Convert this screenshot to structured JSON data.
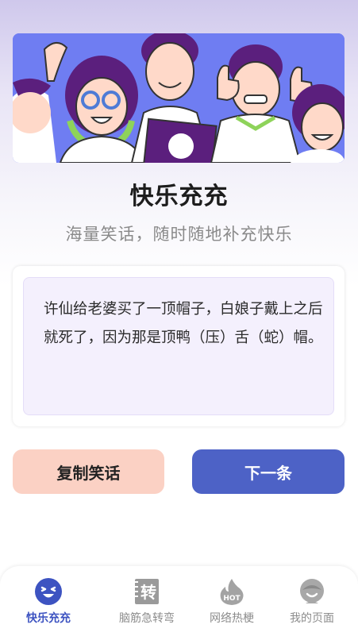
{
  "app": {
    "title": "快乐充充",
    "subtitle": "海量笑话，随时随地补充快乐"
  },
  "joke": {
    "text": "许仙给老婆买了一顶帽子，白娘子戴上之后就死了，因为那是顶鸭（压）舌（蛇）帽。"
  },
  "actions": {
    "copy_label": "复制笑话",
    "next_label": "下一条"
  },
  "tabbar": {
    "items": [
      {
        "label": "快乐充充",
        "icon": "smile-face-icon",
        "active": true
      },
      {
        "label": "脑筋急转弯",
        "icon": "brain-twister-icon",
        "active": false,
        "icon_text": "转"
      },
      {
        "label": "网络热梗",
        "icon": "hot-flame-icon",
        "active": false,
        "icon_text": "HOT"
      },
      {
        "label": "我的页面",
        "icon": "profile-icon",
        "active": false
      }
    ]
  },
  "colors": {
    "accent": "#4d62c6",
    "copy_button": "#fbd1c4",
    "card_bg": "#f4f0fd",
    "banner_bg": "#6f7df2"
  }
}
